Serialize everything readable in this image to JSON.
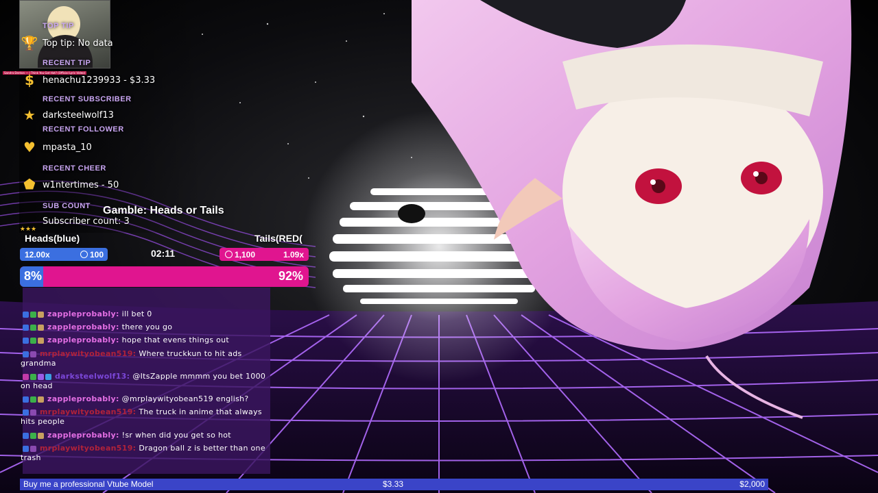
{
  "alerts": {
    "thumb_caption": "Sandra Denton — I Think You Got Hot? (Official Lyric Video)",
    "top_tip_label": "TOP TIP",
    "top_tip_value": "Top tip: No data",
    "recent_tip_label": "RECENT TIP",
    "recent_tip_value": "henachu1239933 - $3.33",
    "recent_sub_label": "RECENT SUBSCRIBER",
    "recent_sub_value": "darksteelwolf13",
    "recent_follower_label": "RECENT FOLLOWER",
    "recent_follower_value": "mpasta_10",
    "recent_cheer_label": "RECENT CHEER",
    "recent_cheer_value": "w1ntertimes - 50",
    "sub_count_label": "SUB COUNT",
    "sub_count_value": "Subscriber count: 3"
  },
  "gamble": {
    "title": "Gamble: Heads or Tails",
    "team_left": "Heads(blue)",
    "team_right": "Tails(RED(",
    "left_multiplier": "12.00x",
    "left_points": "100",
    "timer": "02:11",
    "right_points": "1,100",
    "right_multiplier": "1.09x",
    "left_percent": "8%",
    "right_percent": "92%",
    "left_fraction": 0.08,
    "colors": {
      "blue": "#3b6fe0",
      "pink": "#e0158f"
    }
  },
  "chat": [
    {
      "user": "zappleprobably:",
      "color": "#e46fe4",
      "text": "ill bet 0",
      "badges": [
        "#3b6fe0",
        "#3cb04a",
        "#c8a060"
      ]
    },
    {
      "user": "zappleprobably:",
      "color": "#e46fe4",
      "text": "there you go",
      "badges": [
        "#3b6fe0",
        "#3cb04a",
        "#c8a060"
      ]
    },
    {
      "user": "zappleprobably:",
      "color": "#e46fe4",
      "text": "hope that evens things out",
      "badges": [
        "#3b6fe0",
        "#3cb04a",
        "#c8a060"
      ]
    },
    {
      "user": "mrplaywityobean519:",
      "color": "#b0223a",
      "text": "Where truckkun to hit ads grandma",
      "badges": [
        "#3b6fe0",
        "#8a4ab0"
      ]
    },
    {
      "user": "darksteelwolf13:",
      "color": "#7b47d8",
      "text": "@ItsZapple mmmm you bet 1000 on head",
      "badges": [
        "#c23aa8",
        "#3cb04a",
        "#9b5de5",
        "#3b9fe0"
      ]
    },
    {
      "user": "zappleprobably:",
      "color": "#e46fe4",
      "text": "@mrplaywityobean519 english?",
      "badges": [
        "#3b6fe0",
        "#3cb04a",
        "#c8a060"
      ]
    },
    {
      "user": "mrplaywityobean519:",
      "color": "#b0223a",
      "text": "The truck in anime that always hits people",
      "badges": [
        "#3b6fe0",
        "#8a4ab0"
      ]
    },
    {
      "user": "zappleprobably:",
      "color": "#e46fe4",
      "text": "!sr when did you get so hot",
      "badges": [
        "#3b6fe0",
        "#3cb04a",
        "#c8a060"
      ]
    },
    {
      "user": "mrplaywityobean519:",
      "color": "#b0223a",
      "text": "Dragon ball z is better than one trash",
      "badges": [
        "#3b6fe0",
        "#8a4ab0"
      ]
    }
  ],
  "goal": {
    "label": "Buy me a professional Vtube Model",
    "current": "$3.33",
    "target": "$2,000"
  },
  "icons": {
    "top_tip": "trophy-icon",
    "recent_tip": "dollar-icon",
    "recent_sub": "star-icon",
    "recent_follower": "heart-icon",
    "recent_cheer": "gem-icon",
    "sub_count": "stars-icon"
  }
}
